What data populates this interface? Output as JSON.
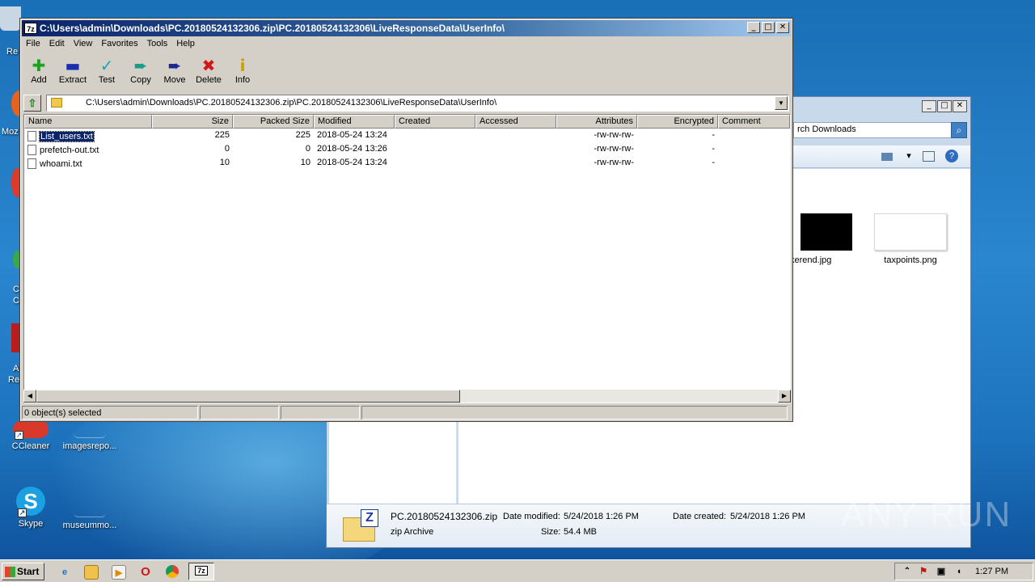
{
  "desktop": {
    "icons": [
      {
        "label": "CCleaner",
        "color": "#d8392b"
      },
      {
        "label": "imagesrepo...",
        "color": "transparent"
      },
      {
        "label": "Skype",
        "color": "#1ba1e2"
      },
      {
        "label": "museummo...",
        "color": "transparent"
      }
    ],
    "left_fragments": [
      "Re",
      "Moz",
      "A",
      "Re",
      "C",
      "C"
    ]
  },
  "explorer": {
    "search_text": "rch Downloads",
    "thumbnails": [
      {
        "label": "kerend.jpg"
      },
      {
        "label": "taxpoints.png"
      }
    ],
    "details": {
      "filename": "PC.20180524132306.zip",
      "date_modified_label": "Date modified:",
      "date_modified": "5/24/2018 1:26 PM",
      "date_created_label": "Date created:",
      "date_created": "5/24/2018 1:26 PM",
      "type": "zip Archive",
      "size_label": "Size:",
      "size": "54.4 MB"
    }
  },
  "sevenzip": {
    "title": "C:\\Users\\admin\\Downloads\\PC.20180524132306.zip\\PC.20180524132306\\LiveResponseData\\UserInfo\\",
    "app_icon_text": "7z",
    "menu": [
      "File",
      "Edit",
      "View",
      "Favorites",
      "Tools",
      "Help"
    ],
    "toolbar": [
      {
        "label": "Add",
        "icon": "plus-icon",
        "glyph": "✚",
        "color": "#20a020"
      },
      {
        "label": "Extract",
        "icon": "minus-icon",
        "glyph": "▬",
        "color": "#1a2fb0"
      },
      {
        "label": "Test",
        "icon": "check-icon",
        "glyph": "✓",
        "color": "#1aa3b8"
      },
      {
        "label": "Copy",
        "icon": "copy-arrow-icon",
        "glyph": "➨",
        "color": "#1a9a8a"
      },
      {
        "label": "Move",
        "icon": "move-arrow-icon",
        "glyph": "➨",
        "color": "#1a2a8a"
      },
      {
        "label": "Delete",
        "icon": "delete-x-icon",
        "glyph": "✖",
        "color": "#d01818"
      },
      {
        "label": "Info",
        "icon": "info-icon",
        "glyph": "i",
        "color": "#c8a000"
      }
    ],
    "address": "C:\\Users\\admin\\Downloads\\PC.20180524132306.zip\\PC.20180524132306\\LiveResponseData\\UserInfo\\",
    "columns": [
      "Name",
      "Size",
      "Packed Size",
      "Modified",
      "Created",
      "Accessed",
      "Attributes",
      "Encrypted",
      "Comment"
    ],
    "files": [
      {
        "name": "List_users.txt",
        "size": "225",
        "packed": "225",
        "modified": "2018-05-24 13:24",
        "created": "",
        "accessed": "",
        "attributes": "-rw-rw-rw-",
        "encrypted": "-",
        "comment": ""
      },
      {
        "name": "prefetch-out.txt",
        "size": "0",
        "packed": "0",
        "modified": "2018-05-24 13:26",
        "created": "",
        "accessed": "",
        "attributes": "-rw-rw-rw-",
        "encrypted": "-",
        "comment": ""
      },
      {
        "name": "whoami.txt",
        "size": "10",
        "packed": "10",
        "modified": "2018-05-24 13:24",
        "created": "",
        "accessed": "",
        "attributes": "-rw-rw-rw-",
        "encrypted": "-",
        "comment": ""
      }
    ],
    "status": "0 object(s) selected"
  },
  "taskbar": {
    "start_label": "Start",
    "clock": "1:27 PM"
  },
  "watermark": "ANY RUN"
}
